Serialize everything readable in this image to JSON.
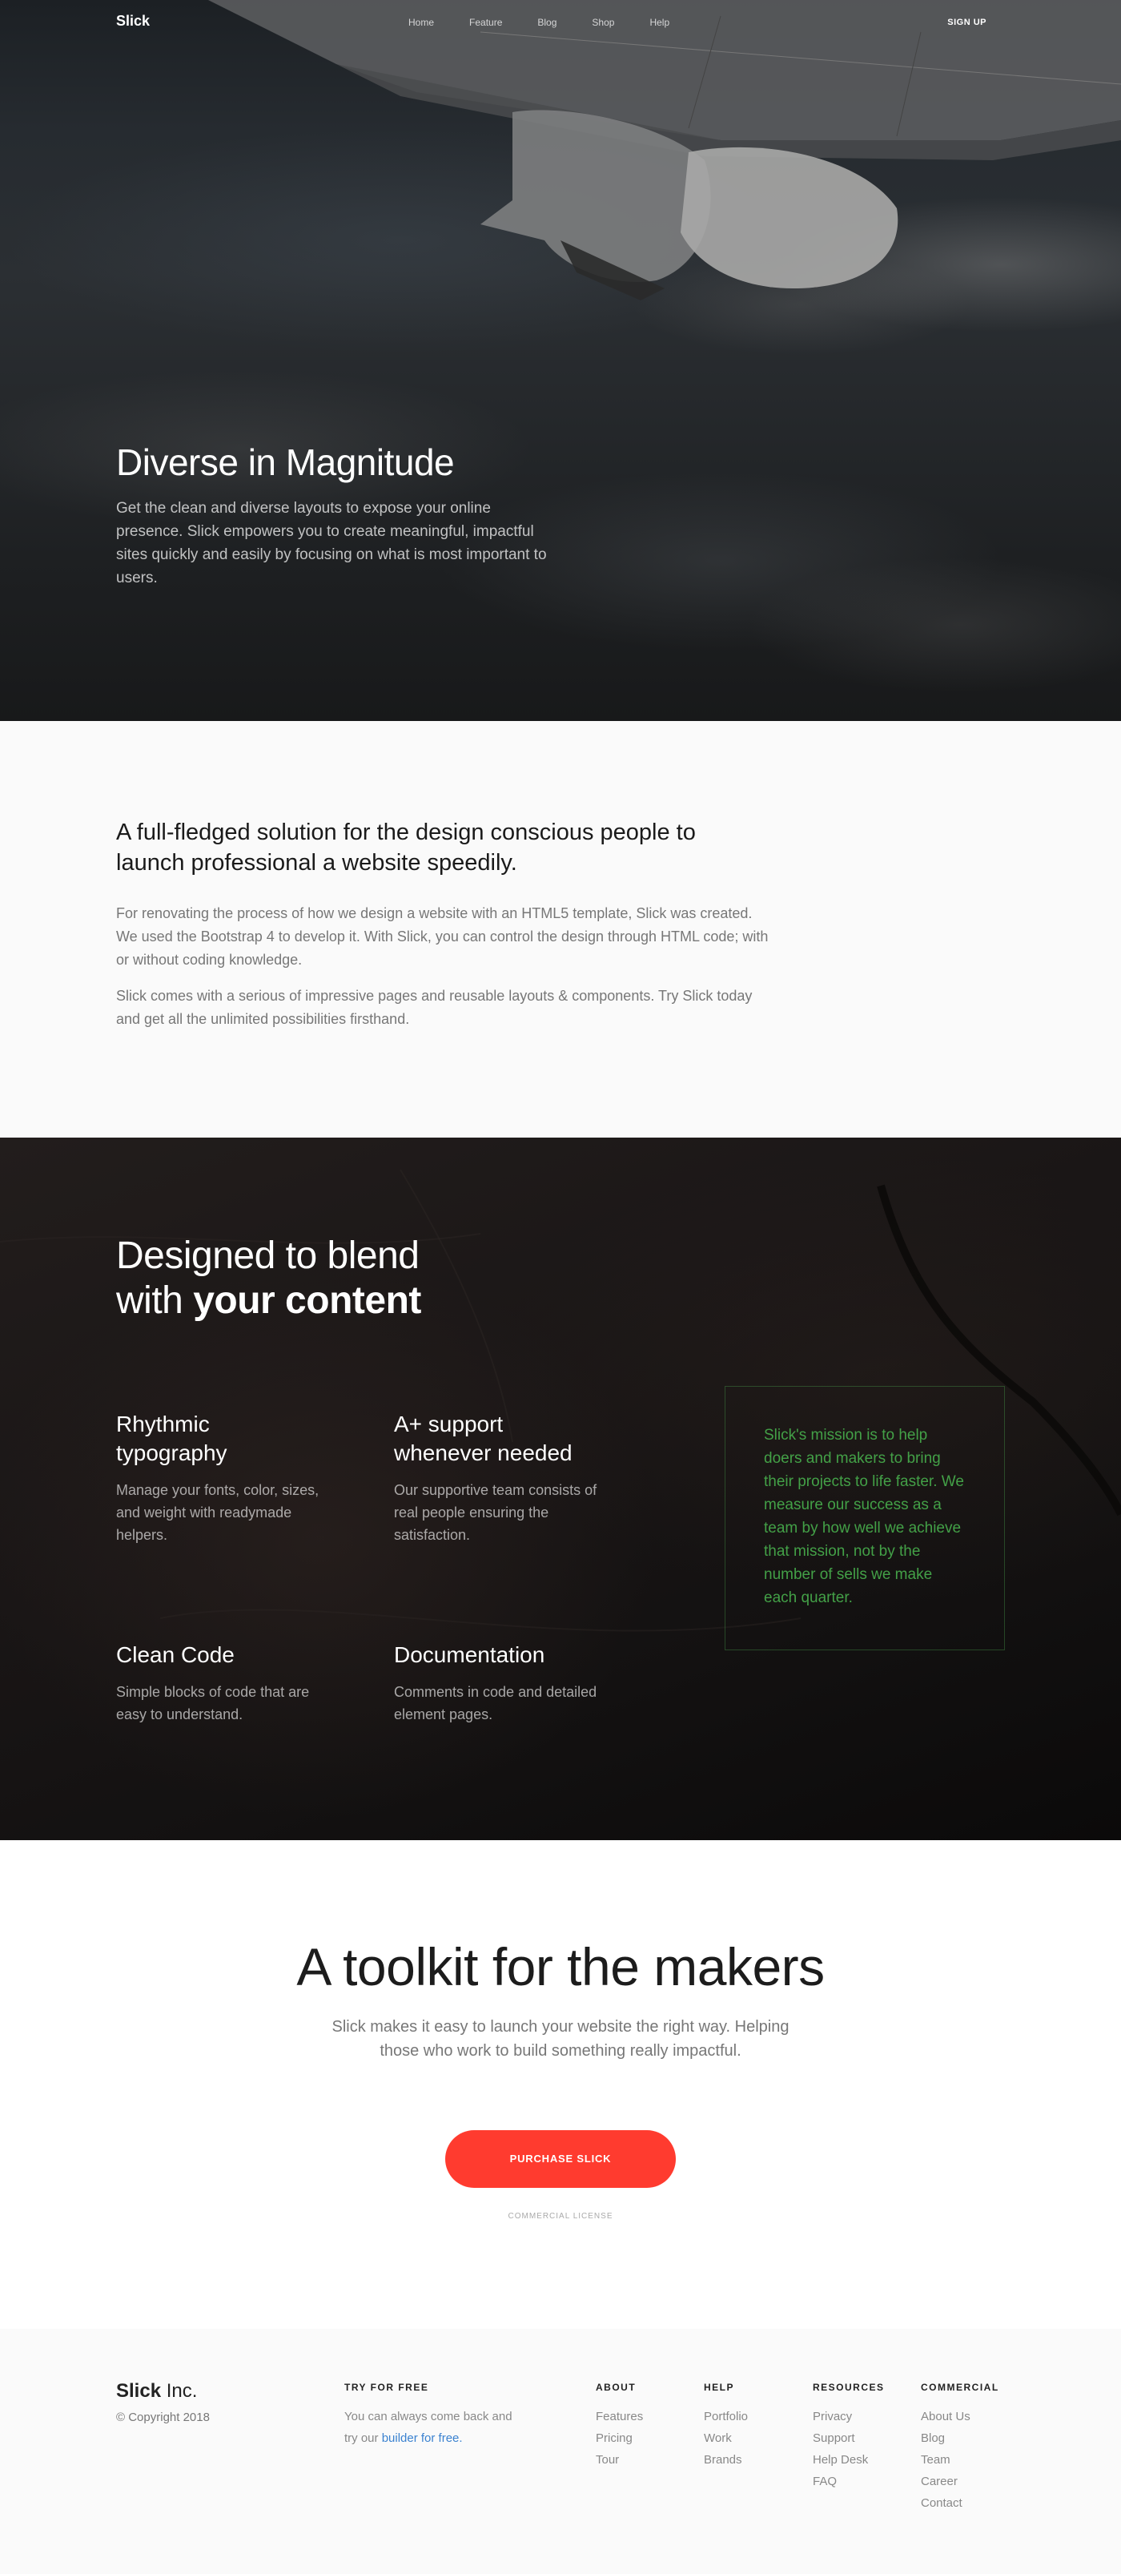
{
  "nav": {
    "brand": "Slick",
    "items": [
      "Home",
      "Feature",
      "Blog",
      "Shop",
      "Help"
    ],
    "signup": "SIGN UP"
  },
  "hero": {
    "title": "Diverse in Magnitude",
    "description": "Get the clean and diverse layouts to expose your online presence. Slick empowers you to create meaningful, impactful sites quickly and easily by focusing on what is most important to users."
  },
  "intro": {
    "heading": "A full-fledged solution for the design conscious people to launch professional a website speedily.",
    "paragraphs": [
      "For renovating the process of how we design a website with an HTML5 template, Slick was created. We used the Bootstrap 4 to develop it. With Slick, you can control the design through HTML code; with or without coding knowledge.",
      "Slick comes with a serious of impressive pages and reusable layouts & components. Try Slick today and get all the unlimited possibilities firsthand."
    ]
  },
  "features": {
    "heading_line1": "Designed to blend",
    "heading_line2_prefix": "with ",
    "heading_line2_bold": "your content",
    "items": [
      {
        "title": "Rhythmic typography",
        "text": "Manage your fonts, color, sizes, and weight with readymade helpers."
      },
      {
        "title": "A+ support whenever needed",
        "text": "Our supportive team consists of real people ensuring the satisfaction."
      },
      {
        "title": "Clean Code",
        "text": "Simple blocks of code that are easy to understand."
      },
      {
        "title": "Documentation",
        "text": "Comments in code and detailed element pages."
      }
    ],
    "mission": "Slick's mission is to help doers and makers to bring their projects to life faster. We measure our success as a team by how well we achieve that mission, not by the number of sells we make each quarter.",
    "mission_color": "#43a047"
  },
  "toolkit": {
    "title": "A toolkit for the makers",
    "description": "Slick makes it easy to launch your website the right way. Helping those who work to build something really impactful.",
    "button": "PURCHASE SLICK",
    "license": "COMMERCIAL LICENSE",
    "button_color": "#ff3b2f"
  },
  "footer": {
    "brand_bold": "Slick",
    "brand_rest": " Inc.",
    "copyright": "© Copyright 2018",
    "try": {
      "heading": "TRY FOR FREE",
      "text": "You can always come back and try our ",
      "link": "builder for free."
    },
    "columns": [
      {
        "heading": "ABOUT",
        "links": [
          "Features",
          "Pricing",
          "Tour"
        ]
      },
      {
        "heading": "HELP",
        "links": [
          "Portfolio",
          "Work",
          "Brands"
        ]
      },
      {
        "heading": "RESOURCES",
        "links": [
          "Privacy",
          "Support",
          "Help Desk",
          "FAQ"
        ]
      },
      {
        "heading": "COMMERCIAL",
        "links": [
          "About Us",
          "Blog",
          "Team",
          "Career",
          "Contact"
        ]
      }
    ]
  }
}
